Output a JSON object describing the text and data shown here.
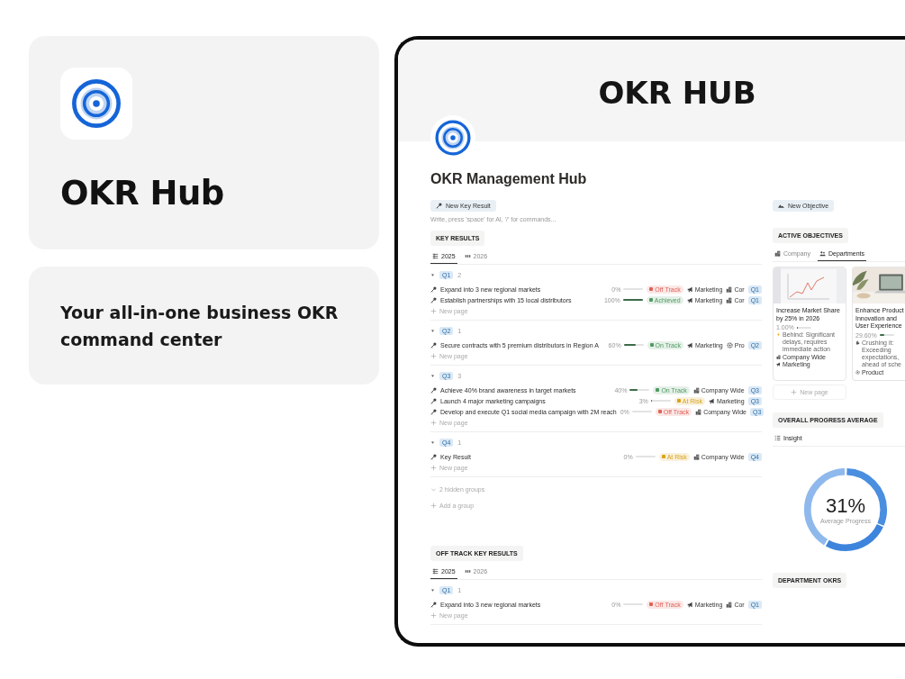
{
  "promo": {
    "app_name": "OKR Hub",
    "tagline": "Your all-in-one business OKR command center"
  },
  "hero": {
    "title": "OKR HUB"
  },
  "page": {
    "title": "OKR Management Hub"
  },
  "left": {
    "button": "New Key Result",
    "placeholder": "Write, press 'space' for AI, '/' for commands...",
    "sections": [
      {
        "title": "KEY RESULTS",
        "views": [
          {
            "label": "2025",
            "selected": true,
            "kind": "table"
          },
          {
            "label": "2026",
            "selected": false,
            "kind": "board"
          }
        ],
        "groups": [
          {
            "label": "Q1",
            "count": "2",
            "rows": [
              {
                "title": "Expand into 3 new regional markets",
                "progress": "0%",
                "level": 0,
                "status": {
                  "label": "Off Track",
                  "color": "#e0625a"
                },
                "tags": [
                  {
                    "kind": "department",
                    "label": "Marketing"
                  },
                  {
                    "kind": "company",
                    "label": "Cor"
                  }
                ],
                "quarter": "Q1"
              },
              {
                "title": "Establish partnerships with 15 local distributors",
                "progress": "100%",
                "level": 1,
                "status": {
                  "label": "Achieved",
                  "color": "#4f9a63"
                },
                "tags": [
                  {
                    "kind": "department",
                    "label": "Marketing"
                  },
                  {
                    "kind": "company",
                    "label": "Cor"
                  }
                ],
                "quarter": "Q1"
              }
            ],
            "new_page": "New page"
          },
          {
            "label": "Q2",
            "count": "1",
            "rows": [
              {
                "title": "Secure contracts with 5 premium distributors in Region A",
                "progress": "60%",
                "level": 0.6,
                "status": {
                  "label": "On Track",
                  "color": "#4f9a63"
                },
                "tags": [
                  {
                    "kind": "department",
                    "label": "Marketing"
                  },
                  {
                    "kind": "product",
                    "label": "Pro"
                  }
                ],
                "quarter": "Q2"
              }
            ],
            "new_page": "New page"
          },
          {
            "label": "Q3",
            "count": "3",
            "rows": [
              {
                "title": "Achieve 40% brand awareness in target markets",
                "progress": "40%",
                "level": 0.4,
                "status": {
                  "label": "On Track",
                  "color": "#4f9a63"
                },
                "tags": [
                  {
                    "kind": "company",
                    "label": "Company Wide"
                  }
                ],
                "quarter": "Q3"
              },
              {
                "title": "Launch 4 major marketing campaigns",
                "progress": "3%",
                "level": 0.03,
                "status": {
                  "label": "At Risk",
                  "color": "#d9a21b"
                },
                "tags": [
                  {
                    "kind": "department",
                    "label": "Marketing"
                  }
                ],
                "quarter": "Q3"
              },
              {
                "title": "Develop and execute Q1 social media campaign with 2M reach",
                "progress": "0%",
                "level": 0,
                "status": {
                  "label": "Off Track",
                  "color": "#e0625a"
                },
                "tags": [
                  {
                    "kind": "company",
                    "label": "Company Wide"
                  }
                ],
                "quarter": "Q3"
              }
            ],
            "new_page": "New page"
          },
          {
            "label": "Q4",
            "count": "1",
            "rows": [
              {
                "title": "Key Result",
                "progress": "0%",
                "level": 0,
                "status": {
                  "label": "At Risk",
                  "color": "#d9a21b"
                },
                "tags": [
                  {
                    "kind": "company",
                    "label": "Company Wide"
                  }
                ],
                "quarter": "Q4"
              }
            ],
            "new_page": "New page"
          }
        ],
        "hidden_groups": "2 hidden groups",
        "add_group": "Add a group"
      },
      {
        "title": "OFF TRACK KEY RESULTS",
        "views": [
          {
            "label": "2025",
            "selected": true,
            "kind": "table"
          },
          {
            "label": "2026",
            "selected": false,
            "kind": "board"
          }
        ],
        "groups": [
          {
            "label": "Q1",
            "count": "1",
            "rows": [
              {
                "title": "Expand into 3 new regional markets",
                "progress": "0%",
                "level": 0,
                "status": {
                  "label": "Off Track",
                  "color": "#e0625a"
                },
                "tags": [
                  {
                    "kind": "department",
                    "label": "Marketing"
                  },
                  {
                    "kind": "company",
                    "label": "Cor"
                  }
                ],
                "quarter": "Q1"
              }
            ],
            "new_page": "New page"
          }
        ]
      }
    ]
  },
  "right": {
    "button": "New Objective",
    "objectives": {
      "title": "ACTIVE OBJECTIVES",
      "tabs": [
        {
          "label": "Company",
          "selected": false,
          "kind": "company"
        },
        {
          "label": "Departments",
          "selected": true,
          "kind": "people"
        }
      ],
      "cards": [
        {
          "title": "Increase Market Share by 25% in 2026",
          "progress": "1.00%",
          "level": 0.01,
          "note": {
            "kind": "behind",
            "text": "Behind: Significant delays, requires immediate action"
          },
          "tags": [
            {
              "kind": "company",
              "label": "Company Wide"
            },
            {
              "kind": "department",
              "label": "Marketing"
            }
          ]
        },
        {
          "title": "Enhance Product Innovation and User Experience",
          "progress": "29.60%",
          "level": 0.3,
          "note": {
            "kind": "ahead",
            "text": "Crushing it: Exceeding expectations, ahead of sche"
          },
          "tags": [
            {
              "kind": "product",
              "label": "Product"
            }
          ]
        }
      ],
      "new_page": "New page"
    },
    "progress": {
      "title": "OVERALL PROGRESS AVERAGE",
      "view": "Insight",
      "value": "31%",
      "caption": "Average Progress"
    },
    "departments": {
      "title": "DEPARTMENT OKRS"
    }
  }
}
